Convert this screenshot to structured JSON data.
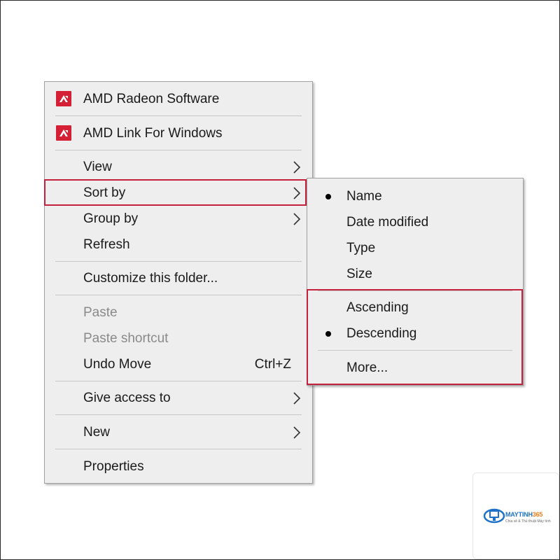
{
  "context_menu": {
    "items": [
      {
        "label": "AMD Radeon Software"
      },
      {
        "label": "AMD Link For Windows"
      },
      {
        "label": "View"
      },
      {
        "label": "Sort by"
      },
      {
        "label": "Group by"
      },
      {
        "label": "Refresh"
      },
      {
        "label": "Customize this folder..."
      },
      {
        "label": "Paste"
      },
      {
        "label": "Paste shortcut"
      },
      {
        "label": "Undo Move",
        "shortcut": "Ctrl+Z"
      },
      {
        "label": "Give access to"
      },
      {
        "label": "New"
      },
      {
        "label": "Properties"
      }
    ]
  },
  "sort_submenu": {
    "items": [
      {
        "label": "Name",
        "checked": true
      },
      {
        "label": "Date modified",
        "checked": false
      },
      {
        "label": "Type",
        "checked": false
      },
      {
        "label": "Size",
        "checked": false
      },
      {
        "label": "Ascending",
        "checked": false
      },
      {
        "label": "Descending",
        "checked": true
      },
      {
        "label": "More...",
        "checked": false
      }
    ]
  },
  "watermark": {
    "brand_main": "MAYTINH",
    "brand_accent": "365",
    "tagline": "Chia sẻ & Thủ thuật Máy tính"
  },
  "colors": {
    "highlight_border": "#c4213e",
    "amd_red": "#d51f35",
    "menu_bg": "#eeeeee",
    "disabled_text": "#8a8a8a"
  },
  "icons": {
    "amd": "amd-logo-icon",
    "submenu_arrow": "chevron-right-icon",
    "radio": "bullet-icon"
  }
}
